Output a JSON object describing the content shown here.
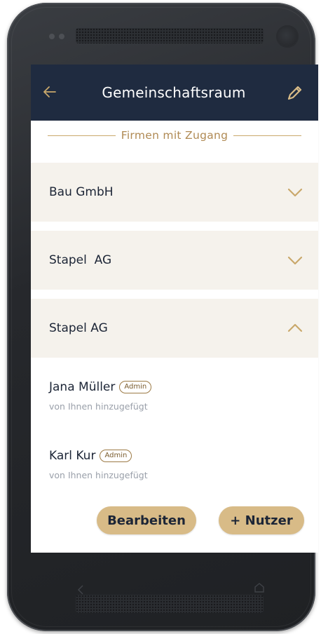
{
  "header": {
    "back_icon": "arrow-left-icon",
    "title": "Gemeinschaftsraum",
    "edit_icon": "pencil-icon"
  },
  "section": {
    "title": "Firmen mit Zugang"
  },
  "companies": [
    {
      "name": "Bau GmbH",
      "expanded": false,
      "chevron": "chevron-down-icon"
    },
    {
      "name": "Stapel  AG",
      "expanded": false,
      "chevron": "chevron-down-icon"
    },
    {
      "name": "Stapel AG",
      "expanded": true,
      "chevron": "chevron-up-icon"
    }
  ],
  "members": [
    {
      "name": "Jana Müller",
      "badge": "Admin",
      "subtitle": "von Ihnen hinzugefügt"
    },
    {
      "name": "Karl Kur",
      "badge": "Admin",
      "subtitle": "von Ihnen hinzugefügt"
    }
  ],
  "actions": {
    "edit_label": "Bearbeiten",
    "add_user_label": "+ Nutzer"
  },
  "colors": {
    "appbar": "#1f2b40",
    "accent": "#c9a86b",
    "button": "#d8bb87",
    "row_bg": "#f5f2ec"
  }
}
